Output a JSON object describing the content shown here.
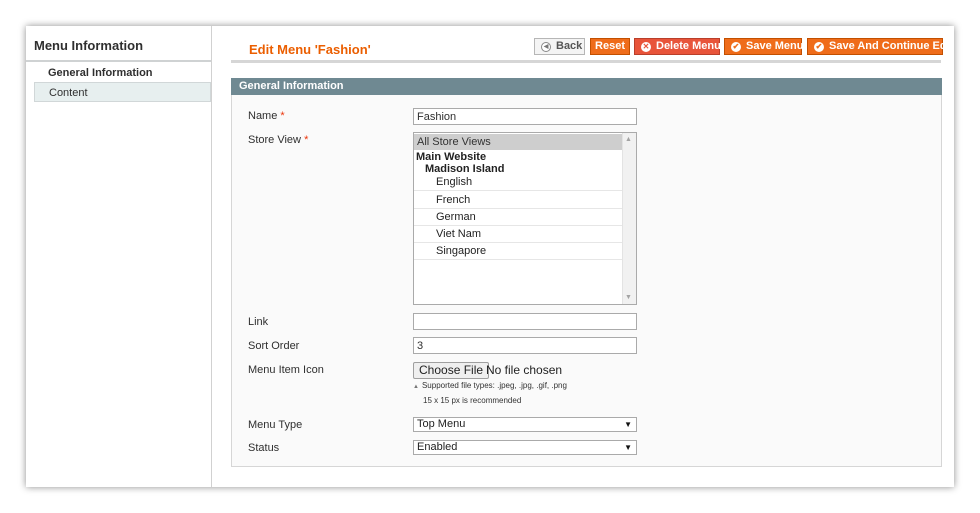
{
  "sidebar": {
    "title": "Menu Information",
    "items": [
      {
        "label": "General Information",
        "active": true
      },
      {
        "label": "Content",
        "active": false
      }
    ]
  },
  "header": {
    "title": "Edit Menu 'Fashion'",
    "buttons": {
      "back": "Back",
      "reset": "Reset",
      "delete": "Delete Menu",
      "save": "Save Menu",
      "save_continue": "Save And Continue Edit"
    }
  },
  "section": {
    "title": "General Information"
  },
  "form": {
    "name": {
      "label": "Name",
      "required": "*",
      "value": "Fashion"
    },
    "store_view": {
      "label": "Store View",
      "required": "*",
      "options": [
        {
          "label": "All Store Views",
          "kind": "selected"
        },
        {
          "label": "Main Website",
          "kind": "group"
        },
        {
          "label": "Madison Island",
          "kind": "subgroup"
        },
        {
          "label": "English",
          "kind": "leaf"
        },
        {
          "label": "French",
          "kind": "leaf"
        },
        {
          "label": "German",
          "kind": "leaf"
        },
        {
          "label": "Viet Nam",
          "kind": "leaf"
        },
        {
          "label": "Singapore",
          "kind": "leaf"
        }
      ]
    },
    "link": {
      "label": "Link",
      "value": ""
    },
    "sort_order": {
      "label": "Sort Order",
      "value": "3"
    },
    "menu_item_icon": {
      "label": "Menu Item Icon",
      "button": "Choose File",
      "status": "No file chosen",
      "hint_types": "Supported file types: .jpeg, .jpg, .gif, .png",
      "hint_size": "15 x 15 px is recommended"
    },
    "menu_type": {
      "label": "Menu Type",
      "value": "Top Menu"
    },
    "status": {
      "label": "Status",
      "value": "Enabled"
    }
  },
  "colors": {
    "accent": "#eb5e00",
    "button": "#ef6c1a",
    "delete": "#e8543a",
    "section_header": "#6f8992"
  }
}
